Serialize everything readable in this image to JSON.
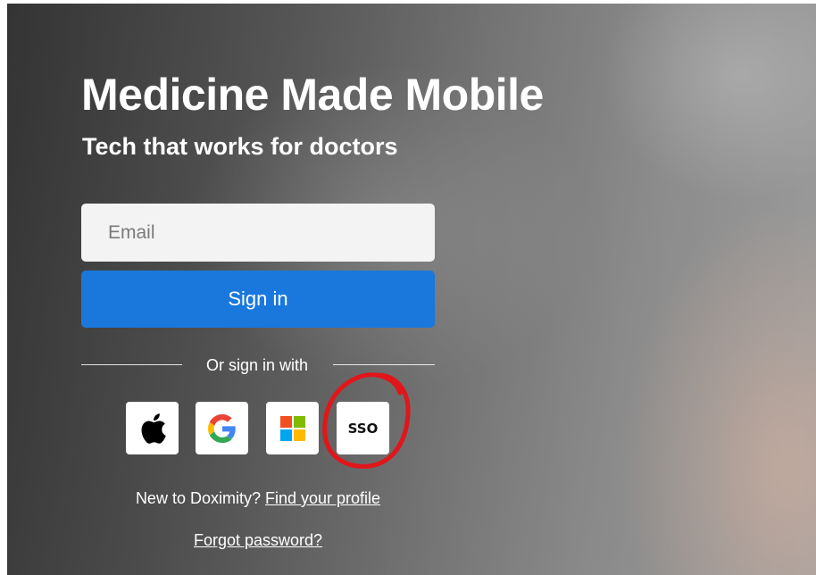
{
  "hero": {
    "title": "Medicine Made Mobile",
    "subtitle": "Tech that works for doctors"
  },
  "login": {
    "email_placeholder": "Email",
    "email_value": "",
    "signin_label": "Sign in",
    "alt_signin_text": "Or sign in with"
  },
  "providers": [
    {
      "icon": "apple-icon"
    },
    {
      "icon": "google-icon"
    },
    {
      "icon": "microsoft-icon"
    },
    {
      "label": "SSO"
    }
  ],
  "footer": {
    "new_text": "New to Doximity?",
    "find_profile_link": "Find your profile",
    "forgot_password_link": "Forgot password?"
  },
  "colors": {
    "primary_button": "#1a78dc",
    "input_background": "#f3f3f3",
    "annotation": "#e0161b"
  }
}
